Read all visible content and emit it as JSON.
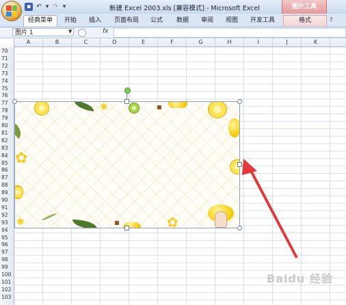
{
  "window": {
    "title": "新建 Excel 2003.xls  [兼容模式] - Microsoft Excel",
    "context_tab_group": "图片工具"
  },
  "ribbon": {
    "tabs": [
      {
        "label": "经典菜单",
        "active": true
      },
      {
        "label": "开始"
      },
      {
        "label": "插入"
      },
      {
        "label": "页面布局"
      },
      {
        "label": "公式"
      },
      {
        "label": "数据"
      },
      {
        "label": "审阅"
      },
      {
        "label": "视图"
      },
      {
        "label": "开发工具"
      },
      {
        "label": "格式",
        "contextual": true
      }
    ]
  },
  "formula_bar": {
    "name_box": "图片 1",
    "fx_label": "fx",
    "formula": ""
  },
  "grid": {
    "columns": [
      "A",
      "B",
      "C",
      "D",
      "E",
      "F",
      "G",
      "H",
      "I",
      "J",
      "K"
    ],
    "rows": [
      "70",
      "71",
      "72",
      "73",
      "74",
      "75",
      "76",
      "77",
      "78",
      "79",
      "80",
      "81",
      "82",
      "83",
      "84",
      "85",
      "86",
      "87",
      "88",
      "89",
      "90",
      "91",
      "92",
      "93",
      "94",
      "95",
      "96",
      "97",
      "98",
      "99",
      "100",
      "101",
      "102",
      "103"
    ]
  },
  "picture": {
    "name": "图片 1",
    "selected": true,
    "pattern": "lemon-border"
  },
  "annotation": {
    "arrow_color": "#e23a3a"
  },
  "watermark": "Baidu 经验",
  "colors": {
    "ribbon_bg": "#dbe6f4",
    "context_tab": "#e39a9a",
    "grid_line": "#d8dee8"
  }
}
